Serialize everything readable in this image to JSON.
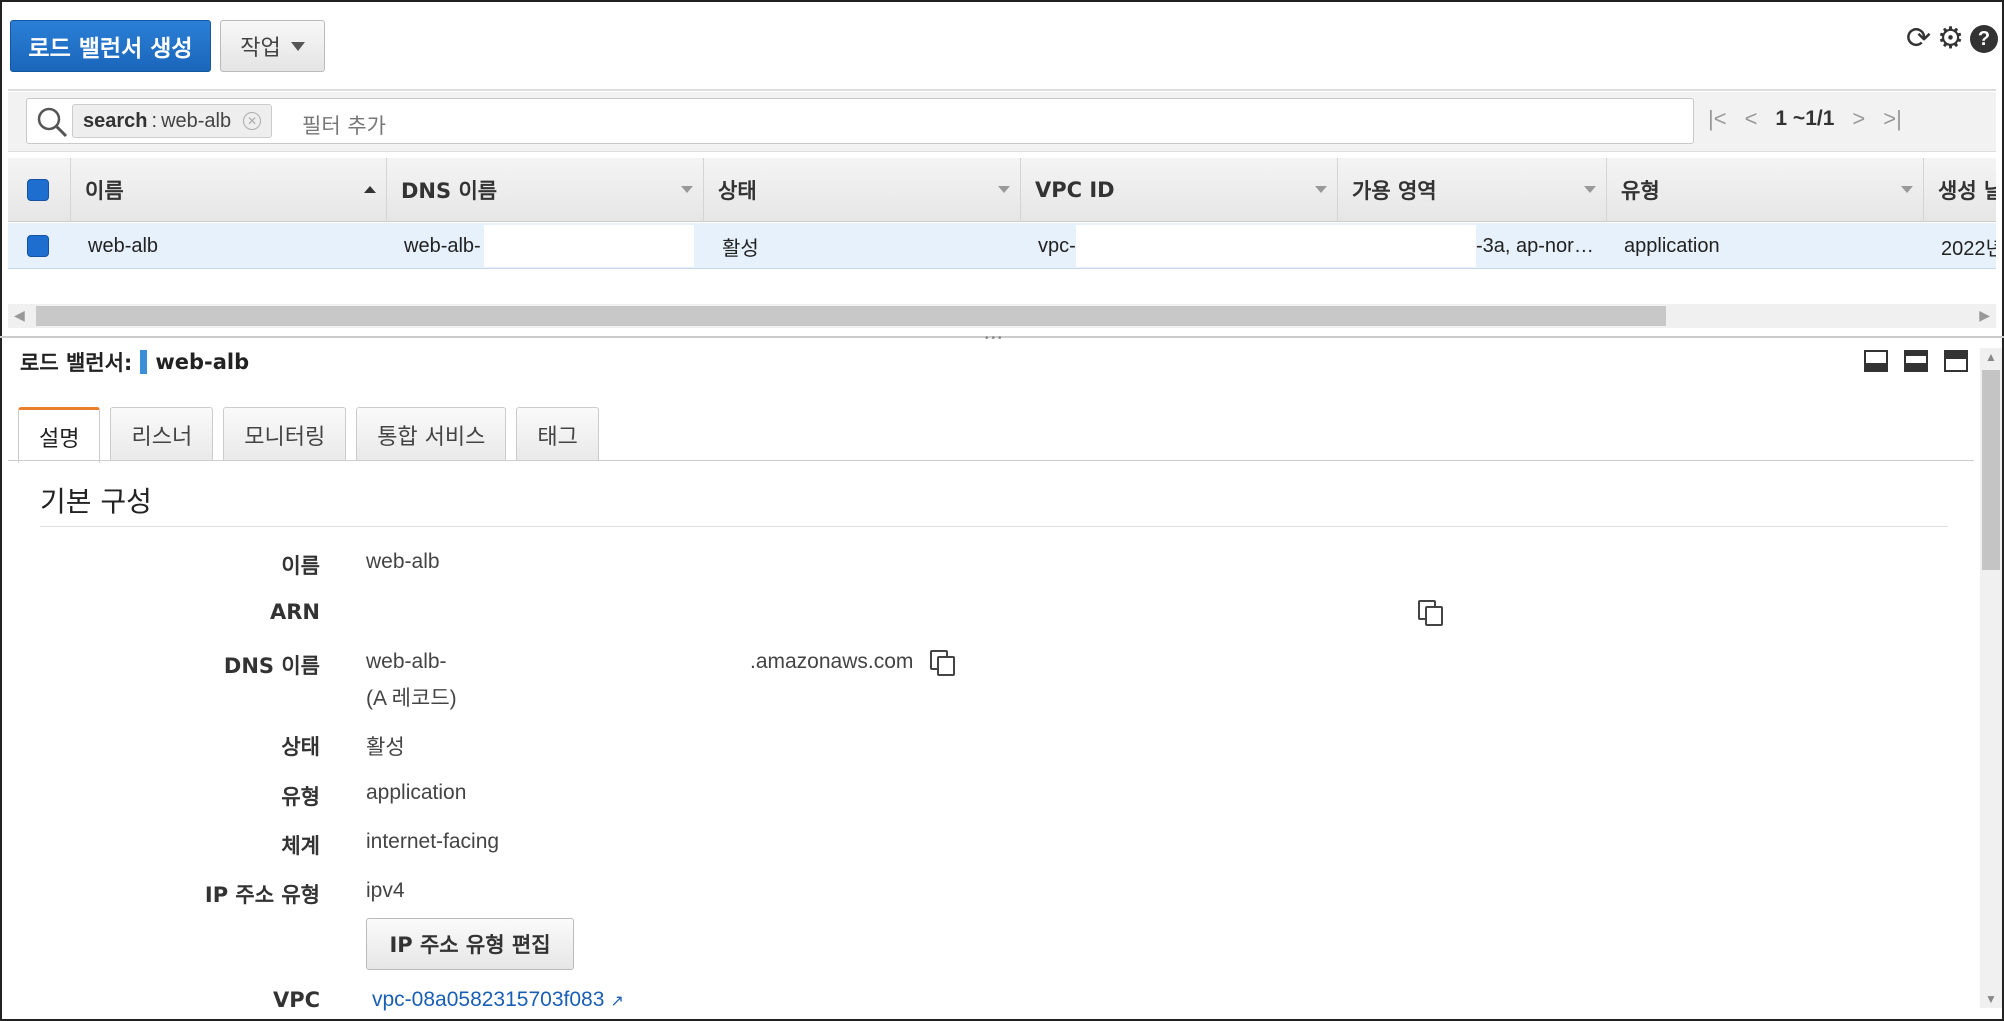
{
  "toolbar": {
    "create_label": "로드 밸런서 생성",
    "actions_label": "작업",
    "icons": [
      "refresh-icon",
      "gear-icon",
      "help-icon"
    ],
    "refresh_glyph": "⟳",
    "gear_glyph": "⚙",
    "help_glyph": "?"
  },
  "filter": {
    "token_key": "search",
    "token_sep": " : ",
    "token_value": "web-alb",
    "placeholder": "필터 추가",
    "pager_text": "1 ~1/1"
  },
  "table": {
    "columns": [
      "이름",
      "DNS 이름",
      "상태",
      "VPC ID",
      "가용 영역",
      "유형",
      "생성 날"
    ],
    "rows": [
      {
        "name": "web-alb",
        "dns": "web-alb-",
        "state": "활성",
        "vpc": "vpc-",
        "az": "-3a, ap-nor…",
        "type": "application",
        "created": "2022년"
      }
    ]
  },
  "detail": {
    "title_prefix": "로드 밸런서:",
    "title_name": "web-alb",
    "tabs": [
      "설명",
      "리스너",
      "모니터링",
      "통합 서비스",
      "태그"
    ],
    "active_tab": "설명",
    "section_title": "기본 구성",
    "fields": {
      "name_label": "이름",
      "name_value": "web-alb",
      "arn_label": "ARN",
      "arn_value": "",
      "dns_label": "DNS 이름",
      "dns_value_start": "web-alb-",
      "dns_value_end": ".amazonaws.com",
      "dns_record": "(A 레코드)",
      "state_label": "상태",
      "state_value": "활성",
      "type_label": "유형",
      "type_value": "application",
      "scheme_label": "체계",
      "scheme_value": "internet-facing",
      "ip_label": "IP 주소 유형",
      "ip_value": "ipv4",
      "ip_edit_button": "IP 주소 유형 편집",
      "vpc_label": "VPC",
      "vpc_value": "vpc-08a0582315703f083"
    }
  }
}
